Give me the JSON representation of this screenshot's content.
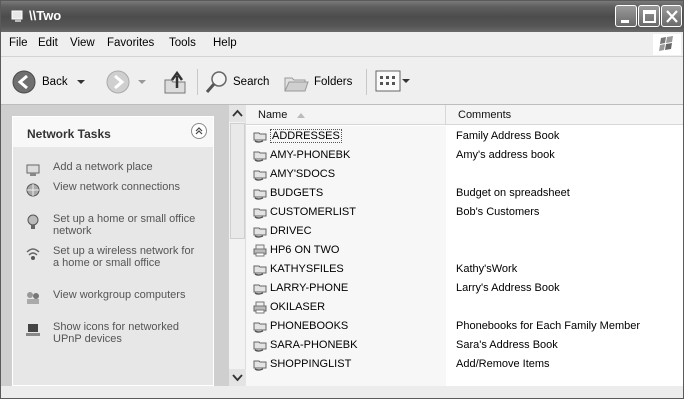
{
  "window": {
    "title": "\\\\Two"
  },
  "menu": [
    "File",
    "Edit",
    "View",
    "Favorites",
    "Tools",
    "Help"
  ],
  "toolbar": {
    "back_label": "Back",
    "search_label": "Search",
    "folders_label": "Folders"
  },
  "tasks": {
    "title": "Network Tasks",
    "items": [
      {
        "label": "Add a network place",
        "icon": "network-place-icon"
      },
      {
        "label": "View network connections",
        "icon": "network-connections-icon"
      },
      {
        "label": "Set up a home or small office network",
        "icon": "home-network-icon"
      },
      {
        "label": "Set up a wireless network for a home or small office",
        "icon": "wireless-network-icon"
      },
      {
        "label": "View workgroup computers",
        "icon": "workgroup-icon"
      },
      {
        "label": "Show icons for networked UPnP devices",
        "icon": "upnp-icon"
      }
    ]
  },
  "list": {
    "columns": {
      "name": "Name",
      "comments": "Comments"
    },
    "rows": [
      {
        "name": "ADDRESSES",
        "comment": "Family Address Book",
        "type": "share"
      },
      {
        "name": "AMY-PHONEBK",
        "comment": "Amy's address book",
        "type": "share"
      },
      {
        "name": "AMY'SDOCS",
        "comment": "",
        "type": "share"
      },
      {
        "name": "BUDGETS",
        "comment": "Budget on spreadsheet",
        "type": "share"
      },
      {
        "name": "CUSTOMERLIST",
        "comment": "Bob's Customers",
        "type": "share"
      },
      {
        "name": "DRIVEC",
        "comment": "",
        "type": "share"
      },
      {
        "name": "HP6 ON TWO",
        "comment": "",
        "type": "printer"
      },
      {
        "name": "KATHYSFILES",
        "comment": "Kathy'sWork",
        "type": "share"
      },
      {
        "name": "LARRY-PHONE",
        "comment": "Larry's Address Book",
        "type": "share"
      },
      {
        "name": "OKILASER",
        "comment": "",
        "type": "printer"
      },
      {
        "name": "PHONEBOOKS",
        "comment": "Phonebooks for Each Family Member",
        "type": "share"
      },
      {
        "name": "SARA-PHONEBK",
        "comment": "Sara's Address Book",
        "type": "share"
      },
      {
        "name": "SHOPPINGLIST",
        "comment": "Add/Remove Items",
        "type": "share"
      }
    ]
  }
}
